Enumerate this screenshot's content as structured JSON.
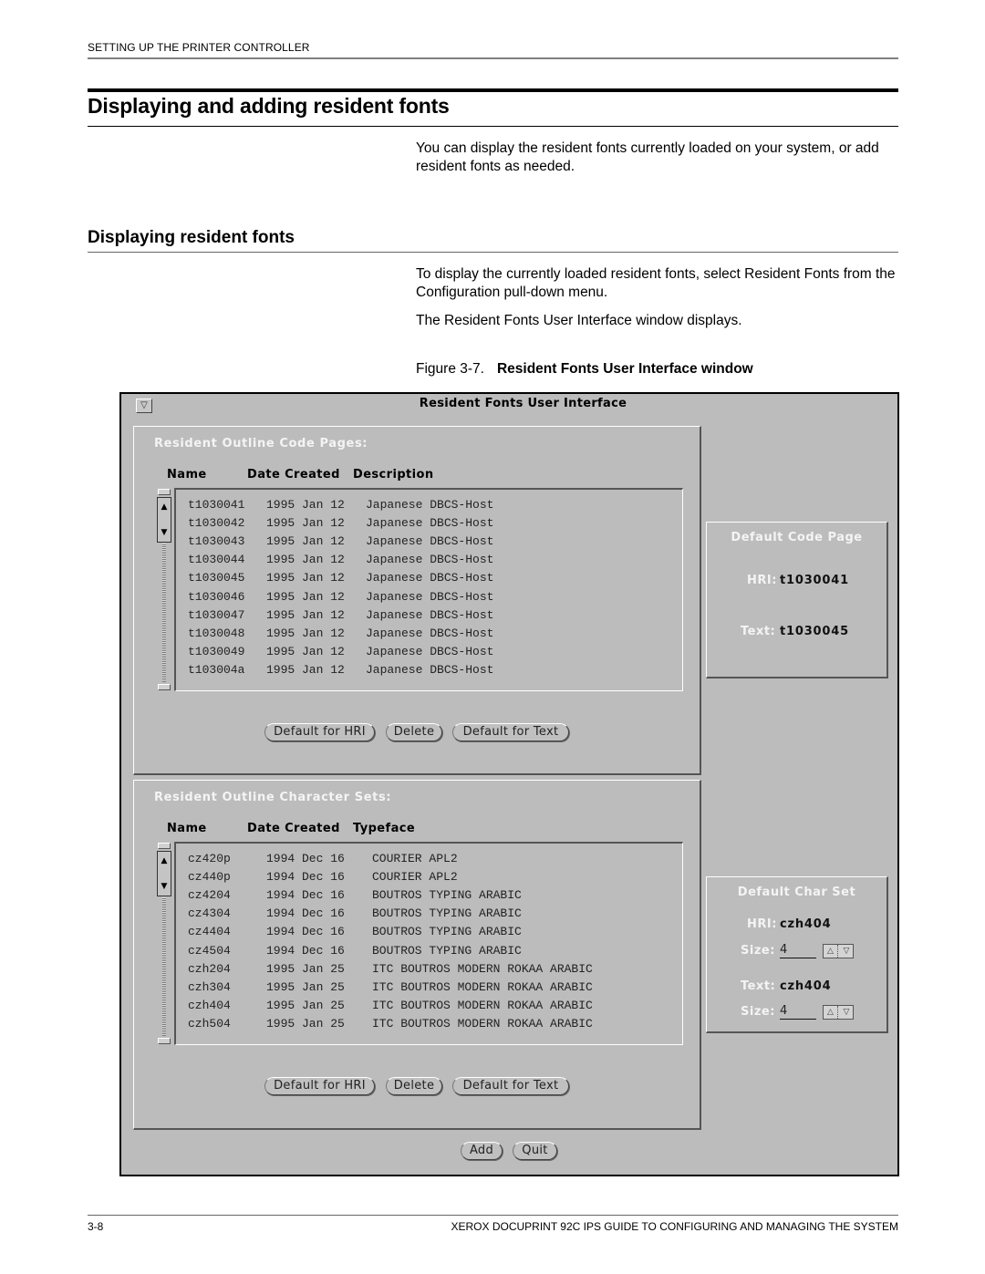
{
  "page": {
    "running_head": "SETTING UP THE PRINTER CONTROLLER",
    "h1": "Displaying and adding resident fonts",
    "intro": "You can display the resident fonts currently loaded on your system, or add resident fonts as needed.",
    "h2": "Displaying resident fonts",
    "para1": "To display the currently loaded resident fonts, select Resident Fonts from the Configuration pull-down menu.",
    "para2": "The Resident Fonts User Interface window displays.",
    "figure_label": "Figure 3-7.",
    "figure_title": "Resident Fonts User Interface window",
    "footer_page": "3-8",
    "footer_title": "XEROX DOCUPRINT 92C IPS GUIDE TO CONFIGURING AND MANAGING THE SYSTEM"
  },
  "window": {
    "menu_icon": "window-menu-triangle",
    "title": "Resident Fonts User Interface",
    "code_pages": {
      "title": "Resident Outline Code Pages:",
      "columns": [
        "Name",
        "Date Created",
        "Description"
      ],
      "rows": [
        [
          "t1030041",
          "1995 Jan 12",
          "Japanese DBCS-Host"
        ],
        [
          "t1030042",
          "1995 Jan 12",
          "Japanese DBCS-Host"
        ],
        [
          "t1030043",
          "1995 Jan 12",
          "Japanese DBCS-Host"
        ],
        [
          "t1030044",
          "1995 Jan 12",
          "Japanese DBCS-Host"
        ],
        [
          "t1030045",
          "1995 Jan 12",
          "Japanese DBCS-Host"
        ],
        [
          "t1030046",
          "1995 Jan 12",
          "Japanese DBCS-Host"
        ],
        [
          "t1030047",
          "1995 Jan 12",
          "Japanese DBCS-Host"
        ],
        [
          "t1030048",
          "1995 Jan 12",
          "Japanese DBCS-Host"
        ],
        [
          "t1030049",
          "1995 Jan 12",
          "Japanese DBCS-Host"
        ],
        [
          "t103004a",
          "1995 Jan 12",
          "Japanese DBCS-Host"
        ]
      ],
      "buttons": {
        "hri": "Default for HRI",
        "delete": "Delete",
        "text": "Default for Text"
      }
    },
    "default_code_page": {
      "title": "Default Code Page",
      "hri_label": "HRI:",
      "hri_value": "t1030041",
      "text_label": "Text:",
      "text_value": "t1030045"
    },
    "char_sets": {
      "title": "Resident Outline Character Sets:",
      "columns": [
        "Name",
        "Date Created",
        "Typeface"
      ],
      "rows": [
        [
          "cz420p",
          "1994 Dec 16",
          "COURIER APL2"
        ],
        [
          "cz440p",
          "1994 Dec 16",
          "COURIER APL2"
        ],
        [
          "cz4204",
          "1994 Dec 16",
          "BOUTROS TYPING ARABIC"
        ],
        [
          "cz4304",
          "1994 Dec 16",
          "BOUTROS TYPING ARABIC"
        ],
        [
          "cz4404",
          "1994 Dec 16",
          "BOUTROS TYPING ARABIC"
        ],
        [
          "cz4504",
          "1994 Dec 16",
          "BOUTROS TYPING ARABIC"
        ],
        [
          "czh204",
          "1995 Jan 25",
          "ITC BOUTROS MODERN ROKAA ARABIC"
        ],
        [
          "czh304",
          "1995 Jan 25",
          "ITC BOUTROS MODERN ROKAA ARABIC"
        ],
        [
          "czh404",
          "1995 Jan 25",
          "ITC BOUTROS MODERN ROKAA ARABIC"
        ],
        [
          "czh504",
          "1995 Jan 25",
          "ITC BOUTROS MODERN ROKAA ARABIC"
        ]
      ],
      "buttons": {
        "hri": "Default for HRI",
        "delete": "Delete",
        "text": "Default for Text"
      }
    },
    "default_char_set": {
      "title": "Default Char Set",
      "hri_label": "HRI:",
      "hri_value": "czh404",
      "hri_size_label": "Size:",
      "hri_size_value": "4",
      "text_label": "Text:",
      "text_value": "czh404",
      "text_size_label": "Size:",
      "text_size_value": "4"
    },
    "footer_buttons": {
      "add": "Add",
      "quit": "Quit"
    },
    "icons": {
      "scroll_up": "▲",
      "scroll_down": "▼",
      "spin_up": "△",
      "spin_down": "▽",
      "menu": "▽"
    }
  }
}
